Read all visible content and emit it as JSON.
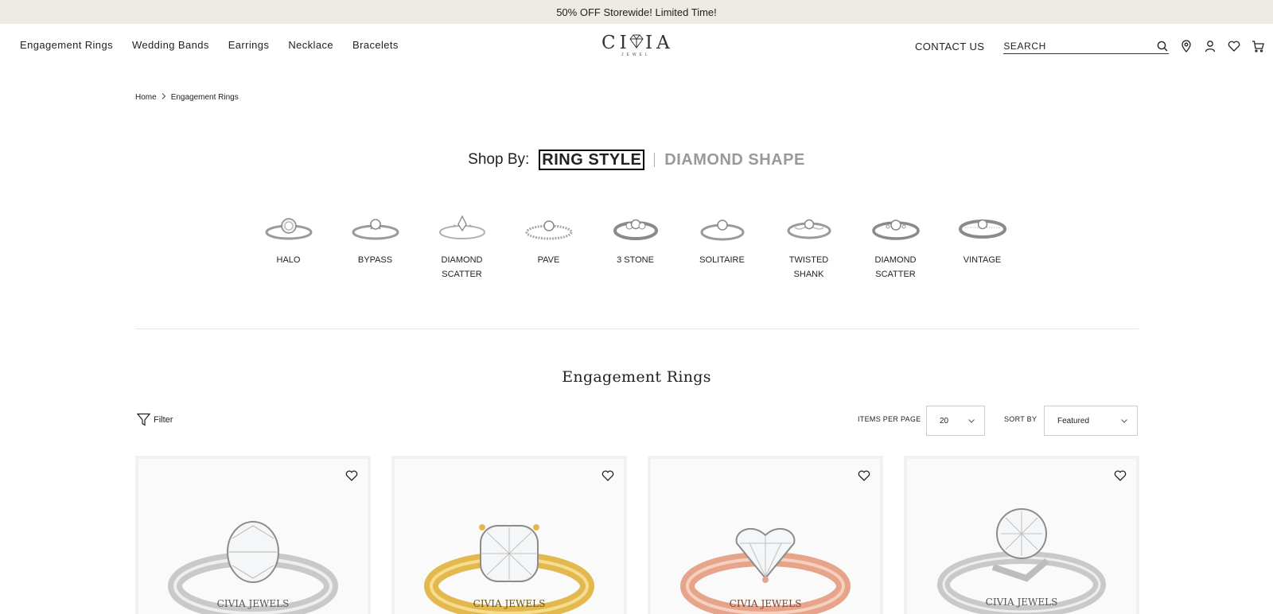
{
  "promo": {
    "text": "50% OFF Storewide! Limited Time!"
  },
  "nav": {
    "items": [
      "Engagement Rings",
      "Wedding Bands",
      "Earrings",
      "Necklace",
      "Bracelets"
    ]
  },
  "logo": {
    "main": "CIVIA",
    "sub": "JEWEL"
  },
  "header": {
    "contact": "CONTACT US",
    "search_placeholder": "SEARCH"
  },
  "icons": [
    "search-icon",
    "location-icon",
    "account-icon",
    "wishlist-icon",
    "cart-icon"
  ],
  "breadcrumb": {
    "home": "Home",
    "current": "Engagement Rings"
  },
  "shopby": {
    "label": "Shop By:",
    "active_tab": "RING STYLE",
    "inactive_tab": "DIAMOND SHAPE"
  },
  "ring_styles": [
    {
      "label": "HALO"
    },
    {
      "label": "BYPASS"
    },
    {
      "label": "DIAMOND SCATTER"
    },
    {
      "label": "PAVE"
    },
    {
      "label": "3 STONE"
    },
    {
      "label": "SOLITAIRE"
    },
    {
      "label": "TWISTED SHANK"
    },
    {
      "label": "DIAMOND SCATTER"
    },
    {
      "label": "VINTAGE"
    }
  ],
  "section": {
    "title": "Engagement Rings"
  },
  "toolbar": {
    "filter": "Filter",
    "items_per_page_label": "ITEMS PER PAGE",
    "items_per_page_value": "20",
    "sort_by_label": "SORT BY",
    "sort_by_value": "Featured"
  },
  "products": [
    {
      "metal": "white gold",
      "engraving": "CIVIA JEWELS",
      "metal_color": "#c9c9c9"
    },
    {
      "metal": "yellow gold",
      "engraving": "CIVIA JEWELS",
      "metal_color": "#e3b94f"
    },
    {
      "metal": "rose gold",
      "engraving": "CIVIA JEWELS",
      "metal_color": "#e6a48a"
    },
    {
      "metal": "white gold",
      "engraving": "CIVIA JEWELS",
      "metal_color": "#c9c9c9"
    }
  ]
}
